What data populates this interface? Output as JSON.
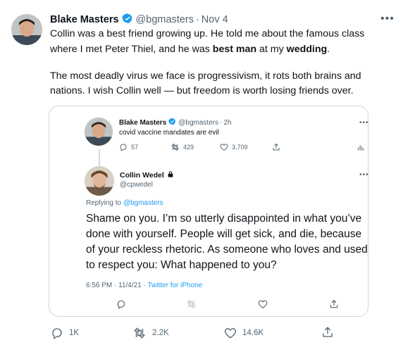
{
  "main_tweet": {
    "author_name": "Blake Masters",
    "handle": "@bgmasters",
    "separator": "·",
    "date": "Nov 4",
    "text_line1": "Collin was a best friend growing up. He told me about the famous class",
    "text_line2_pre": "where I met Peter Thiel, and he was ",
    "text_line2_bold1": "best man",
    "text_line2_mid": " at my ",
    "text_line2_bold2": "wedding",
    "text_line2_end": ".",
    "text_line3": "The most deadly virus we face is progressivism, it rots both brains and",
    "text_line4": "nations. I wish Collin well — but freedom is worth losing friends over.",
    "reply_count": "1K",
    "retweet_count": "2.2K",
    "like_count": "14.6K"
  },
  "quoted_original": {
    "author_name": "Blake Masters",
    "handle": "@bgmasters",
    "separator": "·",
    "time": "2h",
    "text": "covid vaccine mandates are evil",
    "reply_count": "57",
    "retweet_count": "429",
    "like_count": "3,709"
  },
  "quoted_reply": {
    "author_name": "Collin Wedel",
    "handle": "@cpwedel",
    "replying_prefix": "Replying to ",
    "replying_to": "@bgmasters",
    "text_line1": "Shame on you. I’m so utterly disappointed in what you’ve",
    "text_line2": "done with yourself. People will get sick, and die, because",
    "text_line3": "of your reckless rhetoric. As someone who loves and used",
    "text_line4": "to respect you: What happened to you?",
    "timestamp": "6:56 PM · 11/4/21 · ",
    "source": "Twitter for iPhone"
  },
  "icons": {
    "more": "more-icon",
    "verified": "verified-badge-icon",
    "lock": "lock-icon",
    "reply": "reply-icon",
    "retweet": "retweet-icon",
    "like": "like-icon",
    "share": "share-icon",
    "analytics": "analytics-icon"
  },
  "colors": {
    "accent": "#1d9bf0",
    "muted": "#536471",
    "border": "#cfd9de"
  }
}
